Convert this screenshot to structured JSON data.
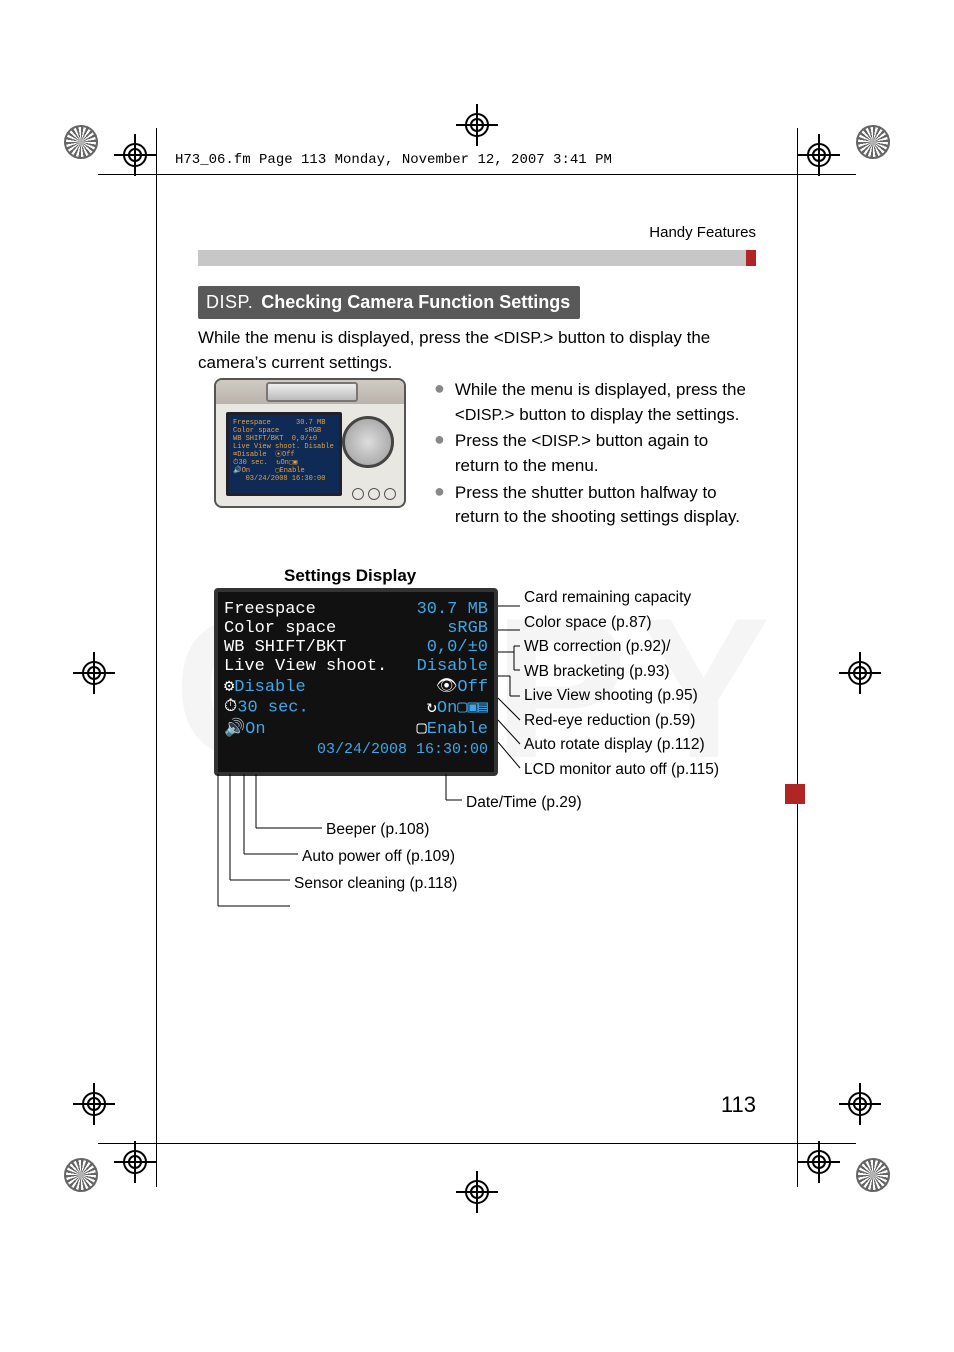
{
  "header_line": "H73_06.fm  Page 113  Monday, November 12, 2007  3:41 PM",
  "breadcrumb": "Handy Features",
  "heading_prefix": "DISP.",
  "heading_text": "Checking Camera Function Settings",
  "intro_pre": "While the menu is displayed, press the <",
  "intro_mid": "DISP.",
  "intro_post": "> button to display the camera’s current settings.",
  "bullets": [
    {
      "pre": "While the menu is displayed, press the <",
      "key": "DISP.",
      "post": "> button to display the settings."
    },
    {
      "pre": "Press the <",
      "key": "DISP.",
      "post": "> button again to return to the menu."
    },
    {
      "pre": "Press the shutter button halfway to return to the shooting settings display.",
      "key": "",
      "post": ""
    }
  ],
  "sd_title": "Settings Display",
  "lcd_rows": [
    {
      "label": "Freespace",
      "value": "30.7 MB"
    },
    {
      "label": "Color space",
      "value": "sRGB"
    },
    {
      "label": "WB SHIFT/BKT",
      "value": "0,0/±0"
    },
    {
      "label": "Live View shoot.",
      "value": "Disable"
    }
  ],
  "lcd_row5": {
    "left_icon": "sensor-clean-icon",
    "left": "Disable",
    "right_icon": "eye-icon",
    "right": "Off"
  },
  "lcd_row6": {
    "left_icon": "power-off-icon",
    "left": "30 sec.",
    "right_icon": "rotate-icon",
    "right": "On▢▣▤"
  },
  "lcd_row7": {
    "left_icon": "beeper-icon",
    "left": "On",
    "right_icon": "lcd-off-icon",
    "right": "Enable"
  },
  "lcd_datetime": "03/24/2008 16:30:00",
  "cam_lcd_lines": "Freespace      30.7 MB\nColor space      sRGB\nWB SHIFT/BKT  0,0/±0\nLive View shoot. Disable\n⌧Disable  ⦿Off\n⏱30 sec.  ↻On▢▣\n🔊On      ▢Enable\n   03/24/2008 16:30:00",
  "callouts_right": [
    "Card remaining capacity",
    "Color space (p.87)",
    "WB correction (p.92)/",
    "WB bracketing (p.93)",
    "Live View shooting (p.95)",
    "Red-eye reduction (p.59)",
    "Auto rotate display (p.112)",
    "LCD monitor auto off (p.115)"
  ],
  "callouts_bot": [
    "Date/Time (p.29)",
    "Beeper (p.108)",
    "Auto power off (p.109)",
    "Sensor cleaning (p.118)"
  ],
  "page_number": "113",
  "watermark": "COPY"
}
